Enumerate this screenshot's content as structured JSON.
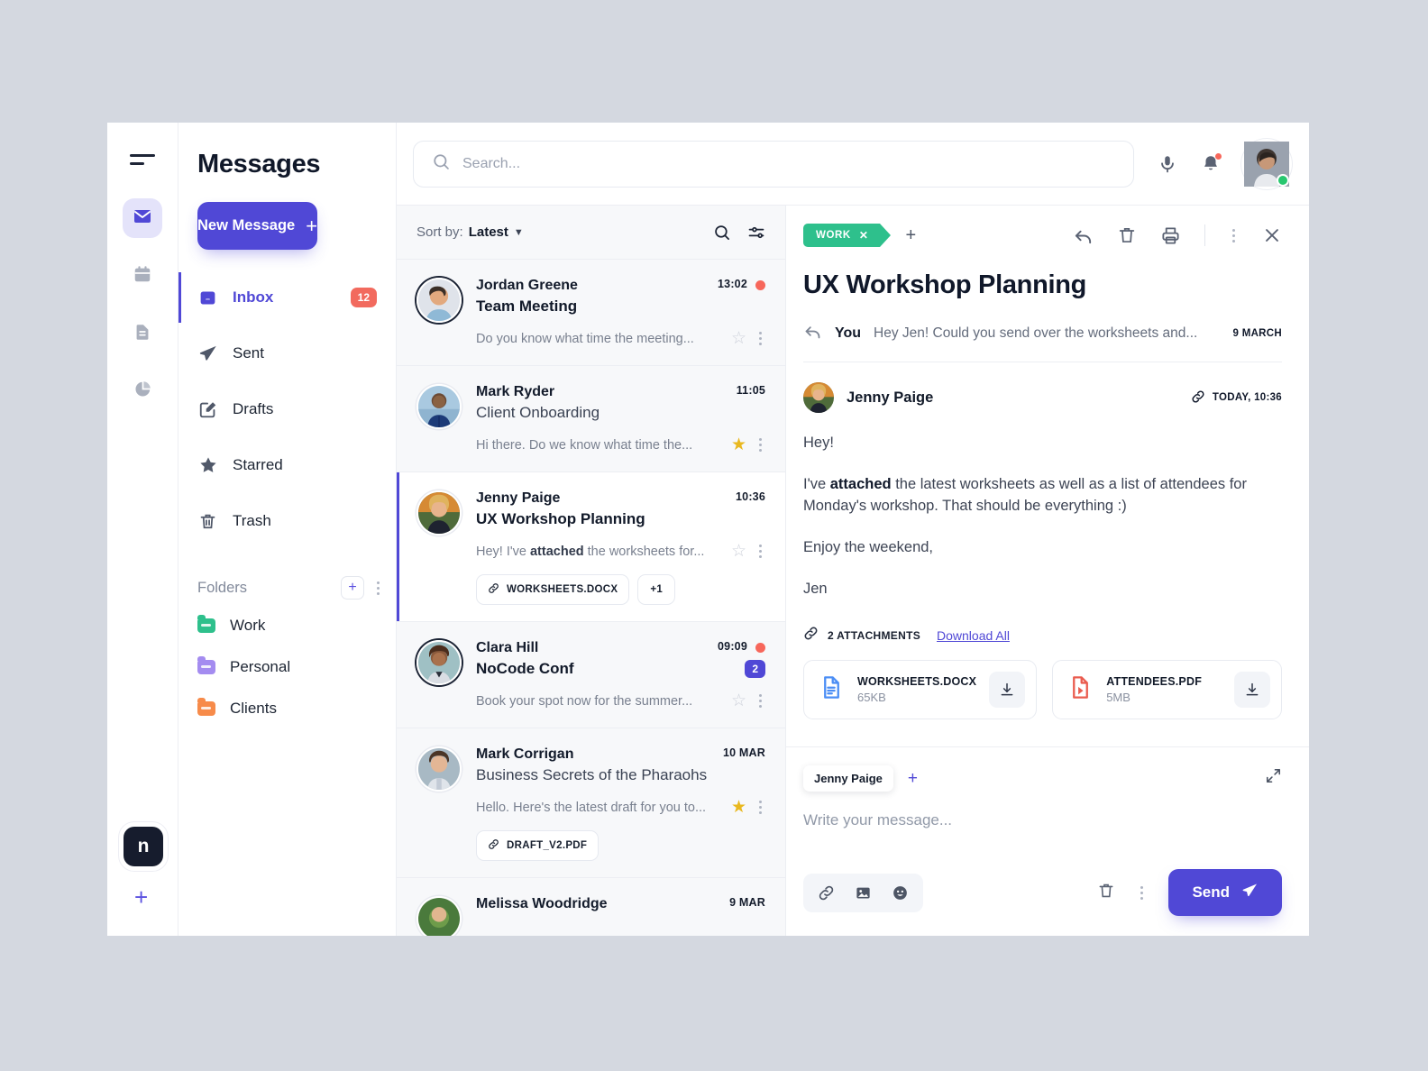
{
  "rail": {
    "items": [
      {
        "icon": "mail-icon",
        "name": "rail-item-mail",
        "active": true
      },
      {
        "icon": "calendar-icon",
        "name": "rail-item-calendar",
        "active": false
      },
      {
        "icon": "document-icon",
        "name": "rail-item-documents",
        "active": false
      },
      {
        "icon": "pie-chart-icon",
        "name": "rail-item-analytics",
        "active": false
      }
    ],
    "logo_letter": "n"
  },
  "sidebar": {
    "title": "Messages",
    "new_message_label": "New Message",
    "nav": [
      {
        "label": "Inbox",
        "icon": "inbox-icon",
        "badge": "12",
        "active": true
      },
      {
        "label": "Sent",
        "icon": "send-icon",
        "badge": "",
        "active": false
      },
      {
        "label": "Drafts",
        "icon": "draft-edit-icon",
        "badge": "",
        "active": false
      },
      {
        "label": "Starred",
        "icon": "star-icon",
        "badge": "",
        "active": false
      },
      {
        "label": "Trash",
        "icon": "trash-icon",
        "badge": "",
        "active": false
      }
    ],
    "folders_heading": "Folders",
    "folders": [
      {
        "label": "Work",
        "color": "#2ec08c"
      },
      {
        "label": "Personal",
        "color": "#a48cf0"
      },
      {
        "label": "Clients",
        "color": "#f78b4a"
      }
    ]
  },
  "search": {
    "placeholder": "Search..."
  },
  "list": {
    "sort_prefix": "Sort by:",
    "sort_value": "Latest",
    "rows": [
      {
        "sender": "Jordan Greene",
        "time": "13:02",
        "subject": "Team Meeting",
        "preview": "Do you know what time the meeting...",
        "preview_bold": "",
        "unread": true,
        "starred": false,
        "count": "",
        "selected": false,
        "attachments": []
      },
      {
        "sender": "Mark Ryder",
        "time": "11:05",
        "subject": "Client Onboarding",
        "preview": "Hi there. Do we know what time the...",
        "preview_bold": "",
        "unread": false,
        "starred": true,
        "count": "",
        "selected": false,
        "attachments": []
      },
      {
        "sender": "Jenny Paige",
        "time": "10:36",
        "subject": "UX Workshop Planning",
        "preview_pre": "Hey! I've ",
        "preview_bold": "attached",
        "preview_post": " the worksheets for...",
        "unread": false,
        "starred": false,
        "count": "",
        "selected": true,
        "attachments": [
          "WORKSHEETS.DOCX",
          "+1"
        ]
      },
      {
        "sender": "Clara Hill",
        "time": "09:09",
        "subject": "NoCode Conf",
        "preview": "Book your spot now for the summer...",
        "preview_bold": "",
        "unread": true,
        "starred": false,
        "count": "2",
        "selected": false,
        "attachments": []
      },
      {
        "sender": "Mark Corrigan",
        "time": "10 MAR",
        "subject": "Business Secrets of the Pharaohs",
        "preview": "Hello. Here's the latest draft for you to...",
        "preview_bold": "",
        "unread": false,
        "starred": true,
        "count": "",
        "selected": false,
        "attachments": [
          "DRAFT_V2.PDF"
        ]
      },
      {
        "sender": "Melissa Woodridge",
        "time": "9 MAR",
        "subject": "",
        "preview": "",
        "preview_bold": "",
        "unread": false,
        "starred": false,
        "count": "",
        "selected": false,
        "attachments": []
      }
    ]
  },
  "detail": {
    "tag_label": "WORK",
    "title": "UX Workshop Planning",
    "thread": {
      "who": "You",
      "snippet": "Hey Jen! Could you send over the worksheets and...",
      "date": "9 MARCH"
    },
    "message": {
      "sender": "Jenny Paige",
      "timestamp": "TODAY, 10:36",
      "paragraphs": [
        {
          "pre": "Hey!",
          "bold": "",
          "post": ""
        },
        {
          "pre": "I've ",
          "bold": "attached",
          "post": " the latest worksheets as well as a list of attendees for Monday's workshop. That should be everything :)"
        },
        {
          "pre": "Enjoy the weekend,",
          "bold": "",
          "post": ""
        },
        {
          "pre": "Jen",
          "bold": "",
          "post": ""
        }
      ]
    },
    "attachments_label": "2 ATTACHMENTS",
    "download_all_label": "Download All",
    "attachments": [
      {
        "name": "WORKSHEETS.DOCX",
        "size": "65KB",
        "type": "docx",
        "color": "#4b8ef5"
      },
      {
        "name": "ATTENDEES.PDF",
        "size": "5MB",
        "type": "pdf",
        "color": "#ea5c4f"
      }
    ]
  },
  "compose": {
    "recipient": "Jenny Paige",
    "placeholder": "Write your message...",
    "send_label": "Send"
  }
}
